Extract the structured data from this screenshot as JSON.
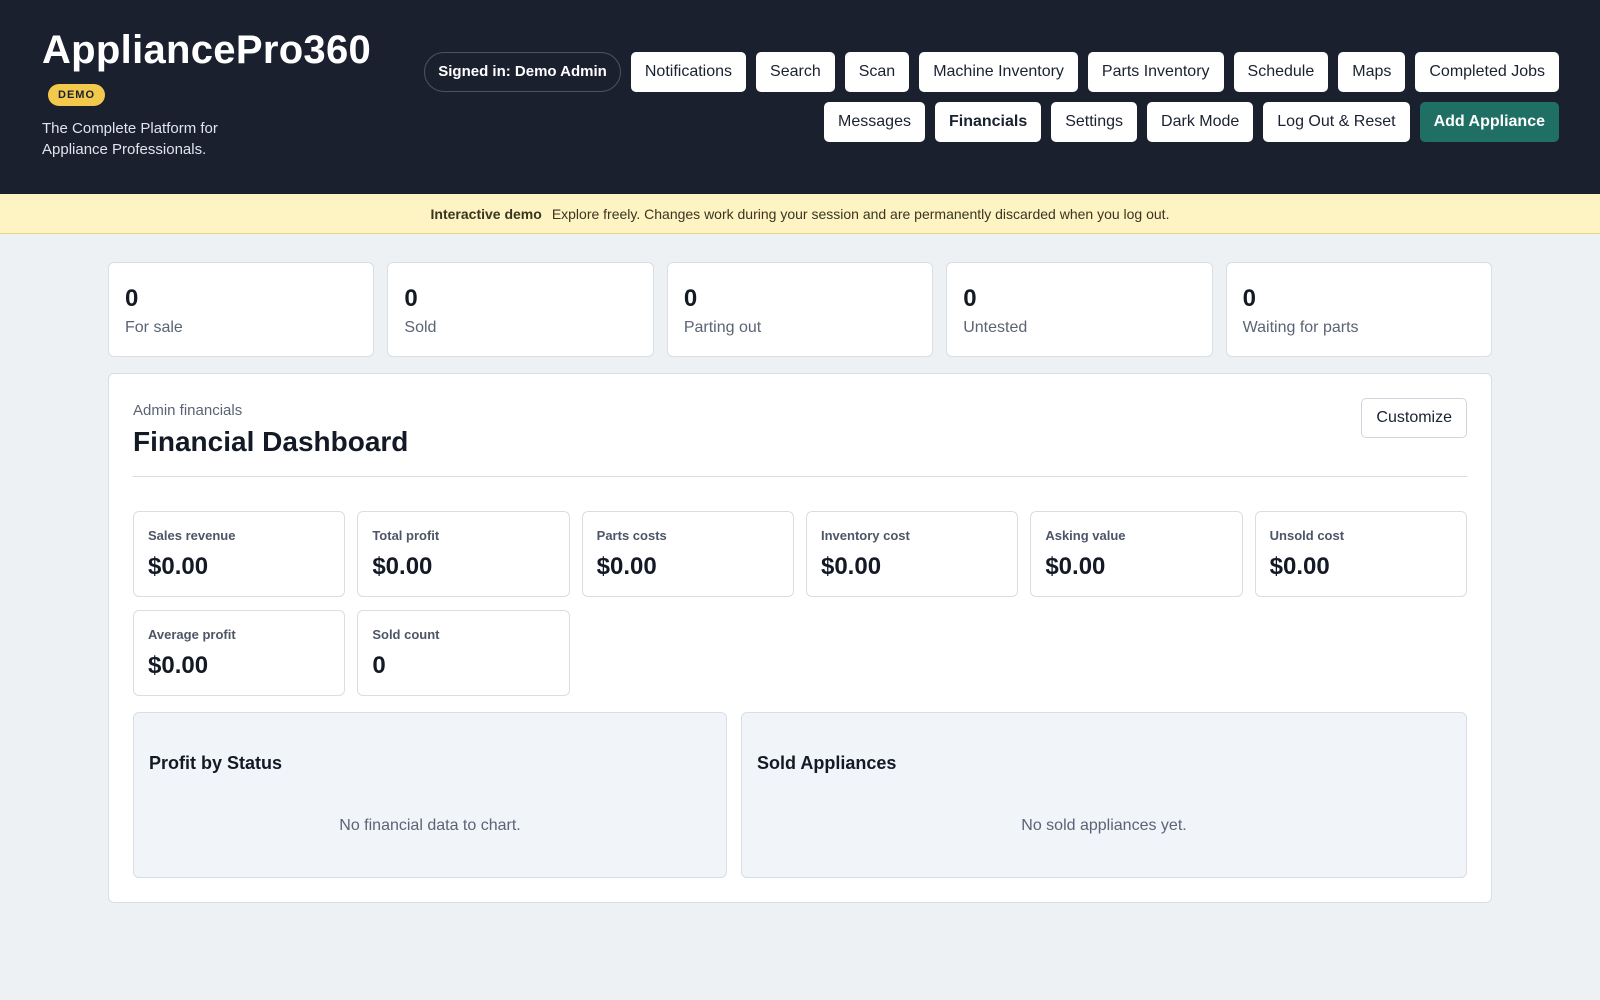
{
  "brand": {
    "title": "AppliancePro360",
    "badge": "DEMO",
    "tagline": "The Complete Platform for Appliance Professionals."
  },
  "header": {
    "signed_in": "Signed in: Demo Admin",
    "nav_row1": [
      "Notifications",
      "Search",
      "Scan",
      "Machine Inventory",
      "Parts Inventory",
      "Schedule",
      "Maps",
      "Completed Jobs"
    ],
    "nav_row2": [
      "Messages",
      "Financials",
      "Settings",
      "Dark Mode",
      "Log Out & Reset",
      "Add Appliance"
    ],
    "active_item": "Financials",
    "primary_item": "Add Appliance"
  },
  "banner": {
    "label": "Interactive demo",
    "text": "Explore freely. Changes work during your session and are permanently discarded when you log out."
  },
  "stats": [
    {
      "value": "0",
      "label": "For sale"
    },
    {
      "value": "0",
      "label": "Sold"
    },
    {
      "value": "0",
      "label": "Parting out"
    },
    {
      "value": "0",
      "label": "Untested"
    },
    {
      "value": "0",
      "label": "Waiting for parts"
    }
  ],
  "dashboard": {
    "eyebrow": "Admin financials",
    "title": "Financial Dashboard",
    "customize_label": "Customize",
    "metrics": [
      {
        "label": "Sales revenue",
        "value": "$0.00"
      },
      {
        "label": "Total profit",
        "value": "$0.00"
      },
      {
        "label": "Parts costs",
        "value": "$0.00"
      },
      {
        "label": "Inventory cost",
        "value": "$0.00"
      },
      {
        "label": "Asking value",
        "value": "$0.00"
      },
      {
        "label": "Unsold cost",
        "value": "$0.00"
      },
      {
        "label": "Average profit",
        "value": "$0.00"
      },
      {
        "label": "Sold count",
        "value": "0"
      }
    ],
    "profit_by_status": {
      "title": "Profit by Status",
      "empty": "No financial data to chart."
    },
    "sold_appliances": {
      "title": "Sold Appliances",
      "empty": "No sold appliances yet."
    }
  },
  "colors": {
    "header_bg": "#1a202e",
    "accent": "#1f6f64",
    "badge": "#f2c94c",
    "banner_bg": "#fdf3c3"
  }
}
